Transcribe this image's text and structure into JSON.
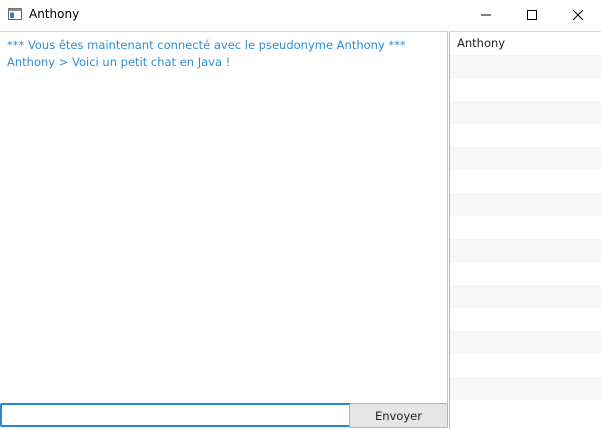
{
  "window": {
    "title": "Anthony",
    "app_icon": "window-icon",
    "controls": [
      "minimize-icon",
      "maximize-icon",
      "close-icon"
    ]
  },
  "chat": {
    "messages": [
      "*** Vous êtes maintenant connecté avec le pseudonyme Anthony ***",
      "Anthony > Voici un petit chat en Java !"
    ],
    "text_color": "#2f8fd6"
  },
  "users": {
    "items": [
      "Anthony"
    ]
  },
  "composer": {
    "input_value": "",
    "send_label": "Envoyer"
  },
  "colors": {
    "accent": "#2a86cf",
    "list_stripe": "#f6f6f6"
  }
}
